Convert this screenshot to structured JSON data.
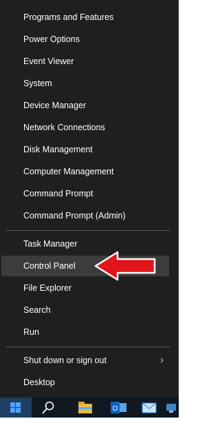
{
  "menu": {
    "items": [
      {
        "label": "Programs and Features"
      },
      {
        "label": "Power Options"
      },
      {
        "label": "Event Viewer"
      },
      {
        "label": "System"
      },
      {
        "label": "Device Manager"
      },
      {
        "label": "Network Connections"
      },
      {
        "label": "Disk Management"
      },
      {
        "label": "Computer Management"
      },
      {
        "label": "Command Prompt"
      },
      {
        "label": "Command Prompt (Admin)"
      },
      {
        "label": "Task Manager"
      },
      {
        "label": "Control Panel"
      },
      {
        "label": "File Explorer"
      },
      {
        "label": "Search"
      },
      {
        "label": "Run"
      },
      {
        "label": "Shut down or sign out"
      },
      {
        "label": "Desktop"
      }
    ],
    "highlighted": "Control Panel",
    "submenu_icon": "chevron-right-icon"
  },
  "annotation": {
    "type": "arrow",
    "color": "#e0161b",
    "points_to": "Control Panel"
  },
  "taskbar": {
    "icons": [
      "windows-start-icon",
      "search-icon",
      "file-explorer-icon",
      "outlook-icon",
      "mail-icon",
      "network-icon"
    ]
  },
  "colors": {
    "menu_bg": "#1f1f1f",
    "highlight_bg": "#3c3c3c",
    "text": "#ffffff",
    "taskbar_bg": "#101820"
  }
}
